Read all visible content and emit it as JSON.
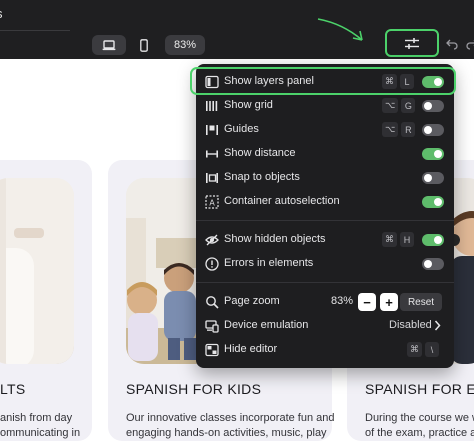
{
  "topbar": {
    "left_label": "s",
    "zoom": "83%"
  },
  "cards": [
    {
      "title": "LTS",
      "desc_lines": [
        "anish from day",
        "ommunicating in"
      ]
    },
    {
      "title": "SPANISH FOR KIDS",
      "desc_lines": [
        "Our innovative classes incorporate fun and",
        "engaging hands-on activities, music, play"
      ]
    },
    {
      "title": "SPANISH FOR EXA",
      "desc_lines": [
        "During the course we will",
        "of the exam, practice all"
      ]
    }
  ],
  "menu": {
    "items": [
      {
        "label": "Show layers panel",
        "keys": [
          "⌘",
          "L"
        ],
        "state": "on",
        "icon": "layers-panel-icon"
      },
      {
        "label": "Show grid",
        "keys": [
          "⌥",
          "G"
        ],
        "state": "off",
        "icon": "grid-icon"
      },
      {
        "label": "Guides",
        "keys": [
          "⌥",
          "R"
        ],
        "state": "off",
        "icon": "guides-icon"
      },
      {
        "label": "Show distance",
        "keys": [],
        "state": "on",
        "icon": "distance-icon"
      },
      {
        "label": "Snap to objects",
        "keys": [],
        "state": "off",
        "icon": "snap-icon"
      },
      {
        "label": "Container autoselection",
        "keys": [],
        "state": "on",
        "icon": "autoselection-icon"
      }
    ],
    "items2": [
      {
        "label": "Show hidden objects",
        "keys": [
          "⌘",
          "H"
        ],
        "state": "on",
        "icon": "eye-off-icon"
      },
      {
        "label": "Errors in elements",
        "keys": [],
        "state": "off",
        "icon": "alert-icon"
      }
    ],
    "page_zoom": {
      "label": "Page zoom",
      "value": "83%",
      "minus": "−",
      "plus": "+",
      "reset": "Reset",
      "icon": "zoom-icon"
    },
    "device_emulation": {
      "label": "Device emulation",
      "value": "Disabled",
      "icon": "device-icon"
    },
    "hide_editor": {
      "label": "Hide editor",
      "keys": [
        "⌘",
        "\\"
      ],
      "icon": "hide-editor-icon"
    }
  },
  "colors": {
    "accent_green": "#5ebc6b",
    "annotation_green": "#4cd26a",
    "menu_bg": "#1e1e20",
    "topbar_bg": "#1f1f21"
  }
}
